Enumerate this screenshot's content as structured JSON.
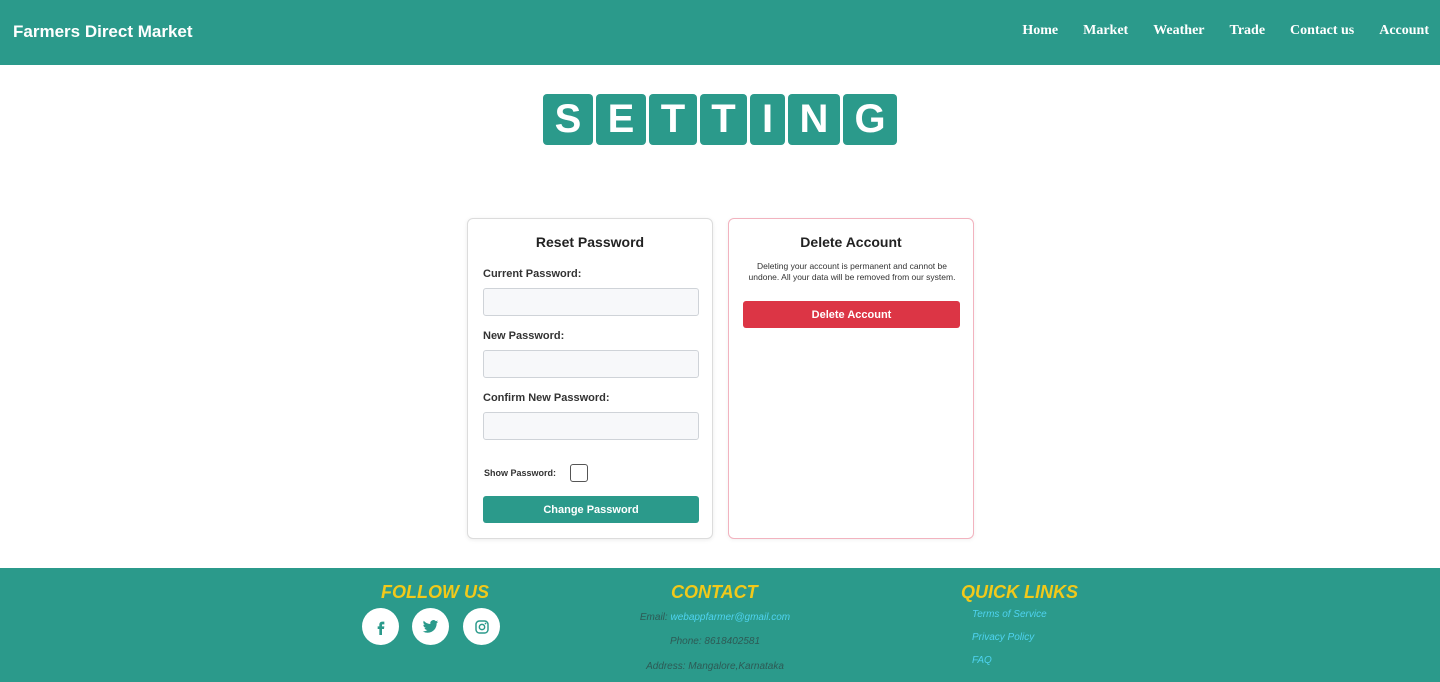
{
  "header": {
    "brand": "Farmers Direct Market",
    "nav": [
      "Home",
      "Market",
      "Weather",
      "Trade",
      "Contact us",
      "Account"
    ]
  },
  "title_letters": [
    "S",
    "E",
    "T",
    "T",
    "I",
    "N",
    "G"
  ],
  "reset_card": {
    "title": "Reset Password",
    "current_label": "Current Password:",
    "new_label": "New Password:",
    "confirm_label": "Confirm New Password:",
    "show_label": "Show Password:",
    "button": "Change Password"
  },
  "delete_card": {
    "title": "Delete Account",
    "warning": "Deleting your account is permanent and cannot be undone. All your data will be removed from our system.",
    "button": "Delete Account"
  },
  "footer": {
    "follow_title": "FOLLOW US",
    "social": [
      "facebook-icon",
      "twitter-icon",
      "instagram-icon"
    ],
    "contact_title": "CONTACT",
    "email_label": "Email:",
    "email": "webappfarmer@gmail.com",
    "phone": "Phone: 8618402581",
    "address": "Address: Mangalore,Karnataka",
    "links_title": "QUICK LINKS",
    "links": [
      "Terms of Service",
      "Privacy Policy",
      "FAQ"
    ]
  },
  "colors": {
    "primary": "#2b9a8b",
    "danger": "#dc3545",
    "footer_heading": "#f2c91a",
    "link": "#4fd3f0"
  }
}
